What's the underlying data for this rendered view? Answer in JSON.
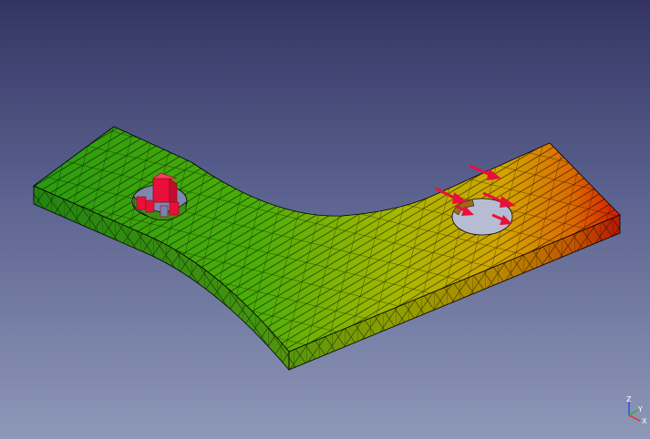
{
  "viewer": {
    "part": "curved-bracket-plate",
    "mesh": "triangular",
    "colors": {
      "background_top": "#333462",
      "background_bottom": "#8e98b8",
      "result_low": "#2fa012",
      "result_mid": "#b0b800",
      "result_high": "#d81d00",
      "constraint_marker": "#e8103a",
      "force_arrow": "#e8103a",
      "axis_x": "#e03030",
      "axis_y": "#30b030",
      "axis_z": "#3050e0"
    },
    "icons": {
      "fixed_constraint": "fixed-constraint-icon",
      "force_load": "force-arrow-icon",
      "navigation": "axis-triad-icon"
    }
  },
  "axes": {
    "x": "X",
    "y": "Y",
    "z": "Z"
  }
}
